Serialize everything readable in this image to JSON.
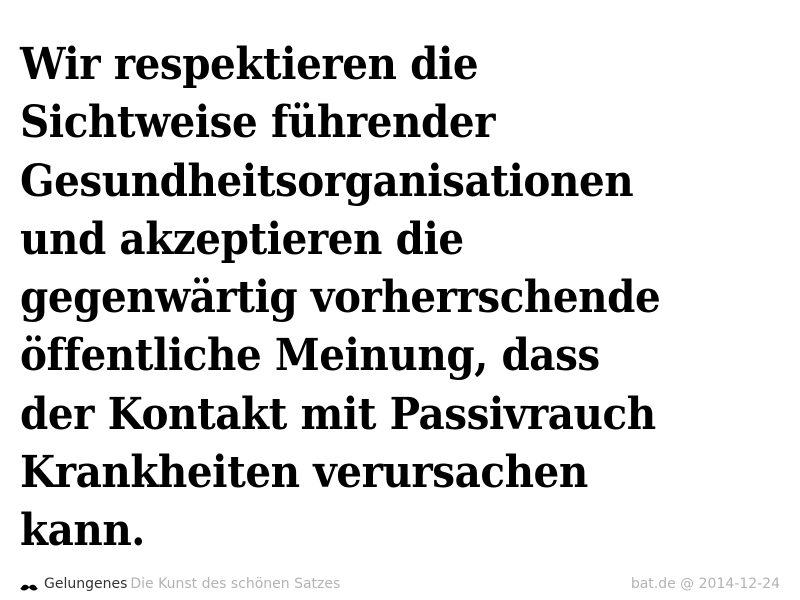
{
  "quote": {
    "lines": [
      "Wir respektieren die",
      "Sichtweise führender",
      "Gesundheitsorganisationen",
      "und akzeptieren die",
      "gegenwärtig vorherrschende",
      "öffentliche Meinung, dass",
      "der Kontakt mit Passivrauch",
      "Krankheiten verursachen",
      "kann."
    ]
  },
  "footer": {
    "icon": "mustache-icon",
    "brand": "Gelungenes",
    "tagline": "Die Kunst des schönen Satzes",
    "attribution": "bat.de @ 2014-12-24"
  },
  "colors": {
    "text": "#000000",
    "brand": "#333333",
    "muted": "#b3b3b3",
    "background": "#ffffff"
  }
}
